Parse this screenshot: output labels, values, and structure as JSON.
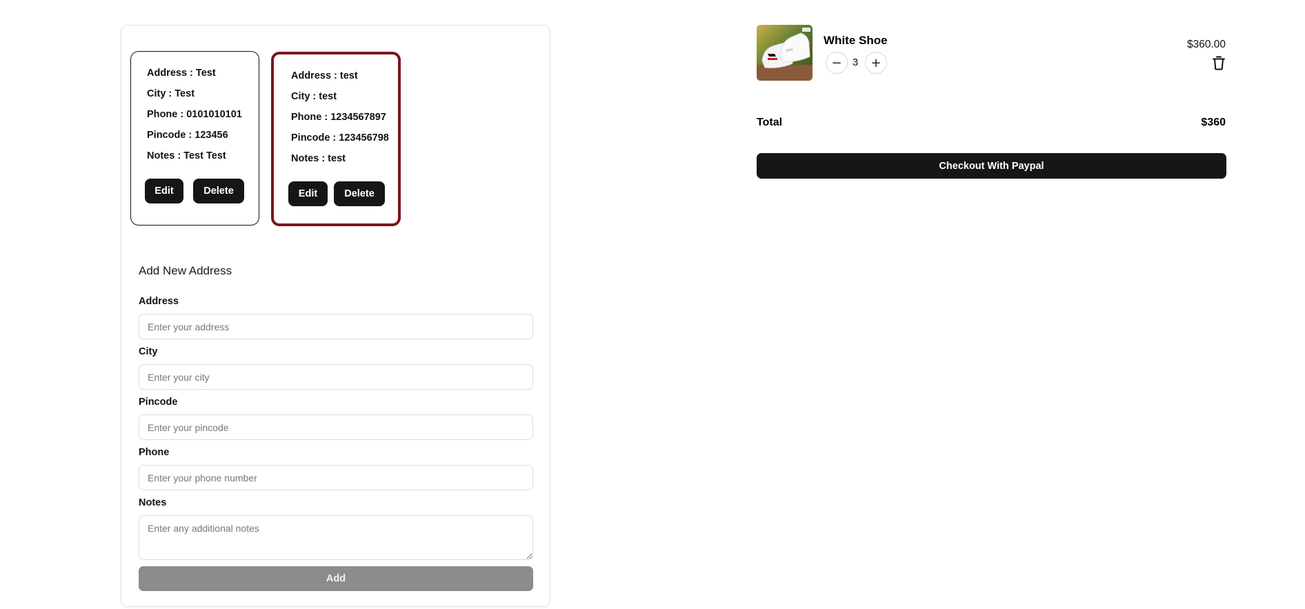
{
  "addresses": [
    {
      "lines": [
        "Address : Test",
        "City : Test",
        "Phone : 0101010101",
        "Pincode : 123456",
        "Notes : Test Test"
      ],
      "edit_label": "Edit",
      "delete_label": "Delete",
      "selected": false
    },
    {
      "lines": [
        "Address : test",
        "City : test",
        "Phone : 1234567897",
        "Pincode : 123456798",
        "Notes : test"
      ],
      "edit_label": "Edit",
      "delete_label": "Delete",
      "selected": true
    }
  ],
  "form": {
    "title": "Add New Address",
    "fields": [
      {
        "label": "Address",
        "placeholder": "Enter your address",
        "value": ""
      },
      {
        "label": "City",
        "placeholder": "Enter your city",
        "value": ""
      },
      {
        "label": "Pincode",
        "placeholder": "Enter your pincode",
        "value": ""
      },
      {
        "label": "Phone",
        "placeholder": "Enter your phone number",
        "value": ""
      },
      {
        "label": "Notes",
        "placeholder": "Enter any additional notes",
        "value": ""
      }
    ],
    "submit_label": "Add"
  },
  "cart": {
    "item": {
      "name": "White Shoe",
      "quantity": "3",
      "price": "$360.00",
      "decrease_symbol": "−",
      "increase_symbol": "+"
    },
    "total_label": "Total",
    "total_value": "$360",
    "checkout_label": "Checkout With Paypal"
  },
  "colors": {
    "selected_border": "#7a1520",
    "button_dark": "#161616",
    "button_disabled": "#8c8c8c"
  }
}
